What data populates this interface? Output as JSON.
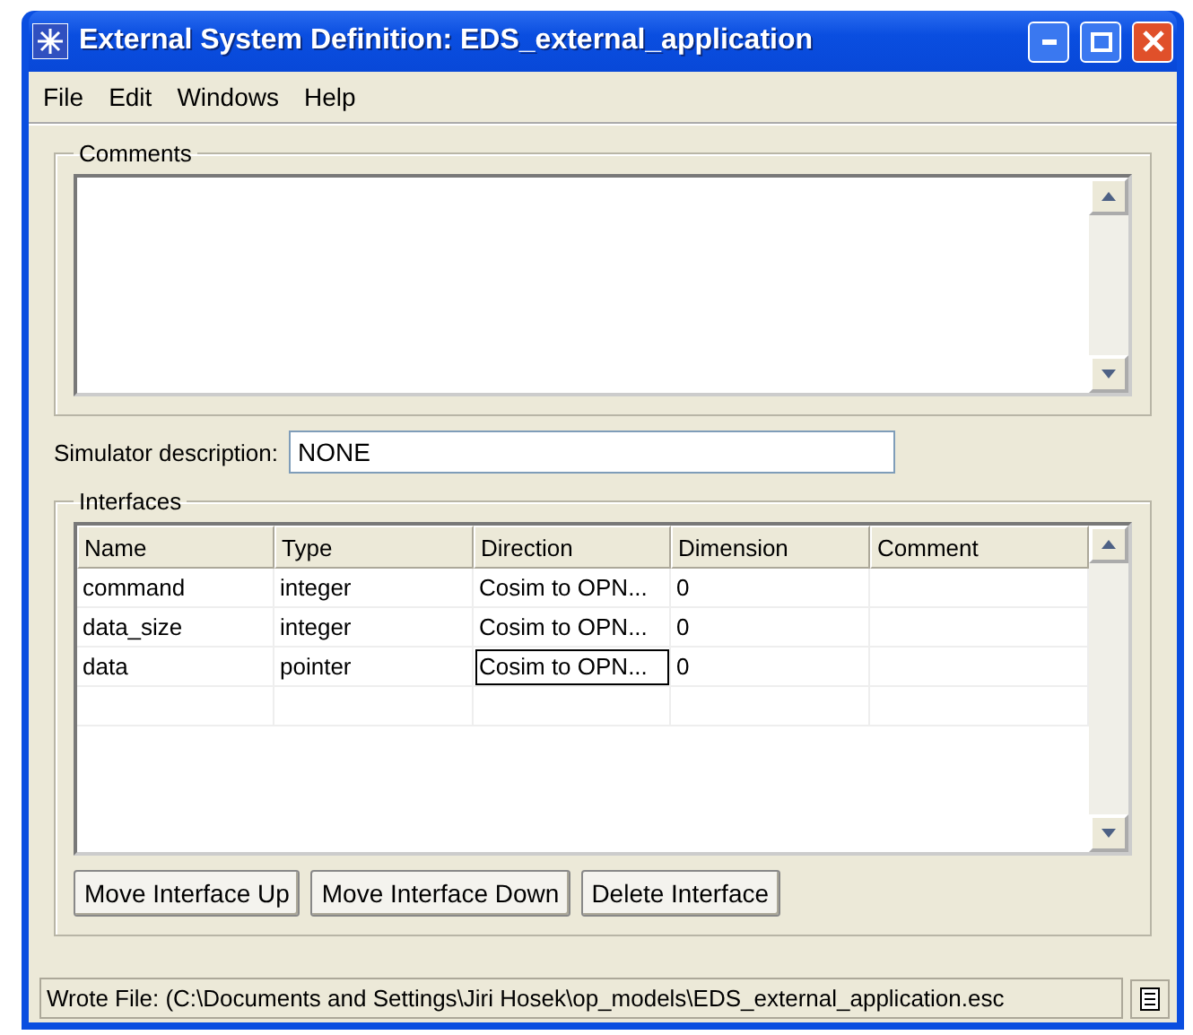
{
  "window": {
    "title": "External System Definition: EDS_external_application"
  },
  "menu": [
    "File",
    "Edit",
    "Windows",
    "Help"
  ],
  "comments": {
    "label": "Comments"
  },
  "simulator": {
    "label": "Simulator description:",
    "value": "NONE"
  },
  "interfaces": {
    "label": "Interfaces",
    "columns": [
      "Name",
      "Type",
      "Direction",
      "Dimension",
      "Comment"
    ],
    "rows": [
      {
        "name": "command",
        "type": "integer",
        "direction": "Cosim to OPN...",
        "dimension": "0",
        "editing": false
      },
      {
        "name": "data_size",
        "type": "integer",
        "direction": "Cosim to OPN...",
        "dimension": "0",
        "editing": false
      },
      {
        "name": "data",
        "type": "pointer",
        "direction": "Cosim to OPN...",
        "dimension": "0",
        "editing": true
      }
    ],
    "buttons": [
      "Move Interface Up",
      "Move Interface Down",
      "Delete Interface"
    ]
  },
  "status_bar": "Wrote File: (C:\\Documents and Settings\\Jiri Hosek\\op_models\\EDS_external_application.esc"
}
